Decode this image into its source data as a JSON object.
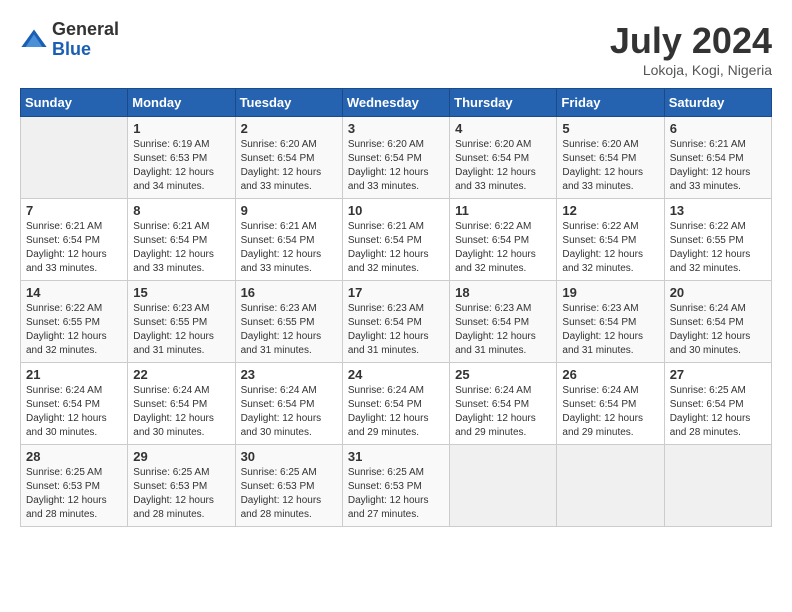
{
  "logo": {
    "general": "General",
    "blue": "Blue"
  },
  "header": {
    "month": "July 2024",
    "location": "Lokoja, Kogi, Nigeria"
  },
  "days_of_week": [
    "Sunday",
    "Monday",
    "Tuesday",
    "Wednesday",
    "Thursday",
    "Friday",
    "Saturday"
  ],
  "weeks": [
    [
      {
        "day": "",
        "sunrise": "",
        "sunset": "",
        "daylight": ""
      },
      {
        "day": "1",
        "sunrise": "Sunrise: 6:19 AM",
        "sunset": "Sunset: 6:53 PM",
        "daylight": "Daylight: 12 hours and 34 minutes."
      },
      {
        "day": "2",
        "sunrise": "Sunrise: 6:20 AM",
        "sunset": "Sunset: 6:54 PM",
        "daylight": "Daylight: 12 hours and 33 minutes."
      },
      {
        "day": "3",
        "sunrise": "Sunrise: 6:20 AM",
        "sunset": "Sunset: 6:54 PM",
        "daylight": "Daylight: 12 hours and 33 minutes."
      },
      {
        "day": "4",
        "sunrise": "Sunrise: 6:20 AM",
        "sunset": "Sunset: 6:54 PM",
        "daylight": "Daylight: 12 hours and 33 minutes."
      },
      {
        "day": "5",
        "sunrise": "Sunrise: 6:20 AM",
        "sunset": "Sunset: 6:54 PM",
        "daylight": "Daylight: 12 hours and 33 minutes."
      },
      {
        "day": "6",
        "sunrise": "Sunrise: 6:21 AM",
        "sunset": "Sunset: 6:54 PM",
        "daylight": "Daylight: 12 hours and 33 minutes."
      }
    ],
    [
      {
        "day": "7",
        "sunrise": "Sunrise: 6:21 AM",
        "sunset": "Sunset: 6:54 PM",
        "daylight": "Daylight: 12 hours and 33 minutes."
      },
      {
        "day": "8",
        "sunrise": "Sunrise: 6:21 AM",
        "sunset": "Sunset: 6:54 PM",
        "daylight": "Daylight: 12 hours and 33 minutes."
      },
      {
        "day": "9",
        "sunrise": "Sunrise: 6:21 AM",
        "sunset": "Sunset: 6:54 PM",
        "daylight": "Daylight: 12 hours and 33 minutes."
      },
      {
        "day": "10",
        "sunrise": "Sunrise: 6:21 AM",
        "sunset": "Sunset: 6:54 PM",
        "daylight": "Daylight: 12 hours and 32 minutes."
      },
      {
        "day": "11",
        "sunrise": "Sunrise: 6:22 AM",
        "sunset": "Sunset: 6:54 PM",
        "daylight": "Daylight: 12 hours and 32 minutes."
      },
      {
        "day": "12",
        "sunrise": "Sunrise: 6:22 AM",
        "sunset": "Sunset: 6:54 PM",
        "daylight": "Daylight: 12 hours and 32 minutes."
      },
      {
        "day": "13",
        "sunrise": "Sunrise: 6:22 AM",
        "sunset": "Sunset: 6:55 PM",
        "daylight": "Daylight: 12 hours and 32 minutes."
      }
    ],
    [
      {
        "day": "14",
        "sunrise": "Sunrise: 6:22 AM",
        "sunset": "Sunset: 6:55 PM",
        "daylight": "Daylight: 12 hours and 32 minutes."
      },
      {
        "day": "15",
        "sunrise": "Sunrise: 6:23 AM",
        "sunset": "Sunset: 6:55 PM",
        "daylight": "Daylight: 12 hours and 31 minutes."
      },
      {
        "day": "16",
        "sunrise": "Sunrise: 6:23 AM",
        "sunset": "Sunset: 6:55 PM",
        "daylight": "Daylight: 12 hours and 31 minutes."
      },
      {
        "day": "17",
        "sunrise": "Sunrise: 6:23 AM",
        "sunset": "Sunset: 6:54 PM",
        "daylight": "Daylight: 12 hours and 31 minutes."
      },
      {
        "day": "18",
        "sunrise": "Sunrise: 6:23 AM",
        "sunset": "Sunset: 6:54 PM",
        "daylight": "Daylight: 12 hours and 31 minutes."
      },
      {
        "day": "19",
        "sunrise": "Sunrise: 6:23 AM",
        "sunset": "Sunset: 6:54 PM",
        "daylight": "Daylight: 12 hours and 31 minutes."
      },
      {
        "day": "20",
        "sunrise": "Sunrise: 6:24 AM",
        "sunset": "Sunset: 6:54 PM",
        "daylight": "Daylight: 12 hours and 30 minutes."
      }
    ],
    [
      {
        "day": "21",
        "sunrise": "Sunrise: 6:24 AM",
        "sunset": "Sunset: 6:54 PM",
        "daylight": "Daylight: 12 hours and 30 minutes."
      },
      {
        "day": "22",
        "sunrise": "Sunrise: 6:24 AM",
        "sunset": "Sunset: 6:54 PM",
        "daylight": "Daylight: 12 hours and 30 minutes."
      },
      {
        "day": "23",
        "sunrise": "Sunrise: 6:24 AM",
        "sunset": "Sunset: 6:54 PM",
        "daylight": "Daylight: 12 hours and 30 minutes."
      },
      {
        "day": "24",
        "sunrise": "Sunrise: 6:24 AM",
        "sunset": "Sunset: 6:54 PM",
        "daylight": "Daylight: 12 hours and 29 minutes."
      },
      {
        "day": "25",
        "sunrise": "Sunrise: 6:24 AM",
        "sunset": "Sunset: 6:54 PM",
        "daylight": "Daylight: 12 hours and 29 minutes."
      },
      {
        "day": "26",
        "sunrise": "Sunrise: 6:24 AM",
        "sunset": "Sunset: 6:54 PM",
        "daylight": "Daylight: 12 hours and 29 minutes."
      },
      {
        "day": "27",
        "sunrise": "Sunrise: 6:25 AM",
        "sunset": "Sunset: 6:54 PM",
        "daylight": "Daylight: 12 hours and 28 minutes."
      }
    ],
    [
      {
        "day": "28",
        "sunrise": "Sunrise: 6:25 AM",
        "sunset": "Sunset: 6:53 PM",
        "daylight": "Daylight: 12 hours and 28 minutes."
      },
      {
        "day": "29",
        "sunrise": "Sunrise: 6:25 AM",
        "sunset": "Sunset: 6:53 PM",
        "daylight": "Daylight: 12 hours and 28 minutes."
      },
      {
        "day": "30",
        "sunrise": "Sunrise: 6:25 AM",
        "sunset": "Sunset: 6:53 PM",
        "daylight": "Daylight: 12 hours and 28 minutes."
      },
      {
        "day": "31",
        "sunrise": "Sunrise: 6:25 AM",
        "sunset": "Sunset: 6:53 PM",
        "daylight": "Daylight: 12 hours and 27 minutes."
      },
      {
        "day": "",
        "sunrise": "",
        "sunset": "",
        "daylight": ""
      },
      {
        "day": "",
        "sunrise": "",
        "sunset": "",
        "daylight": ""
      },
      {
        "day": "",
        "sunrise": "",
        "sunset": "",
        "daylight": ""
      }
    ]
  ]
}
